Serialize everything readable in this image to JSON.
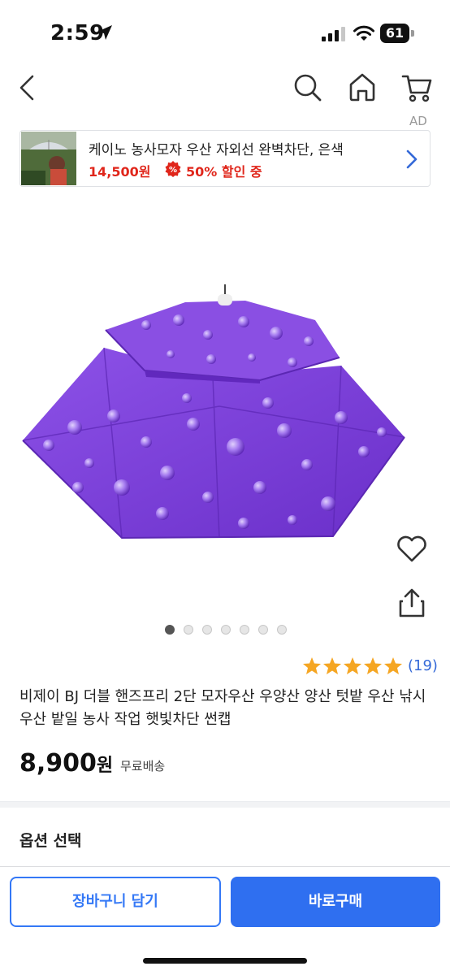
{
  "status_bar": {
    "time": "2:59",
    "battery": "61"
  },
  "nav": {
    "icons": [
      "back-icon",
      "search-icon",
      "home-icon",
      "cart-icon"
    ]
  },
  "ad": {
    "label": "AD",
    "title": "케이노 농사모자 우산 자외선 완벽차단, 은색",
    "price": "14,500원",
    "discount": "50% 할인 중",
    "discount_icon_text": "%"
  },
  "gallery": {
    "image_count": 7,
    "active_index": 0
  },
  "product": {
    "rating_stars": 5,
    "review_count": "(19)",
    "title": "비제이 BJ 더블 핸즈프리 2단 모자우산 우양산 양산 텃밭 우산 낚시우산 밭일 농사 작업 햇빛차단 썬캡",
    "price_number": "8,900",
    "price_unit": "원",
    "shipping": "무료배송"
  },
  "options": {
    "title": "옵션 선택"
  },
  "actions": {
    "add_to_cart": "장바구니 담기",
    "buy_now": "바로구매"
  },
  "colors": {
    "accent": "#3478f6",
    "sale": "#e0261b",
    "star": "#f5a623",
    "umbrella": "#7a3fd6"
  }
}
